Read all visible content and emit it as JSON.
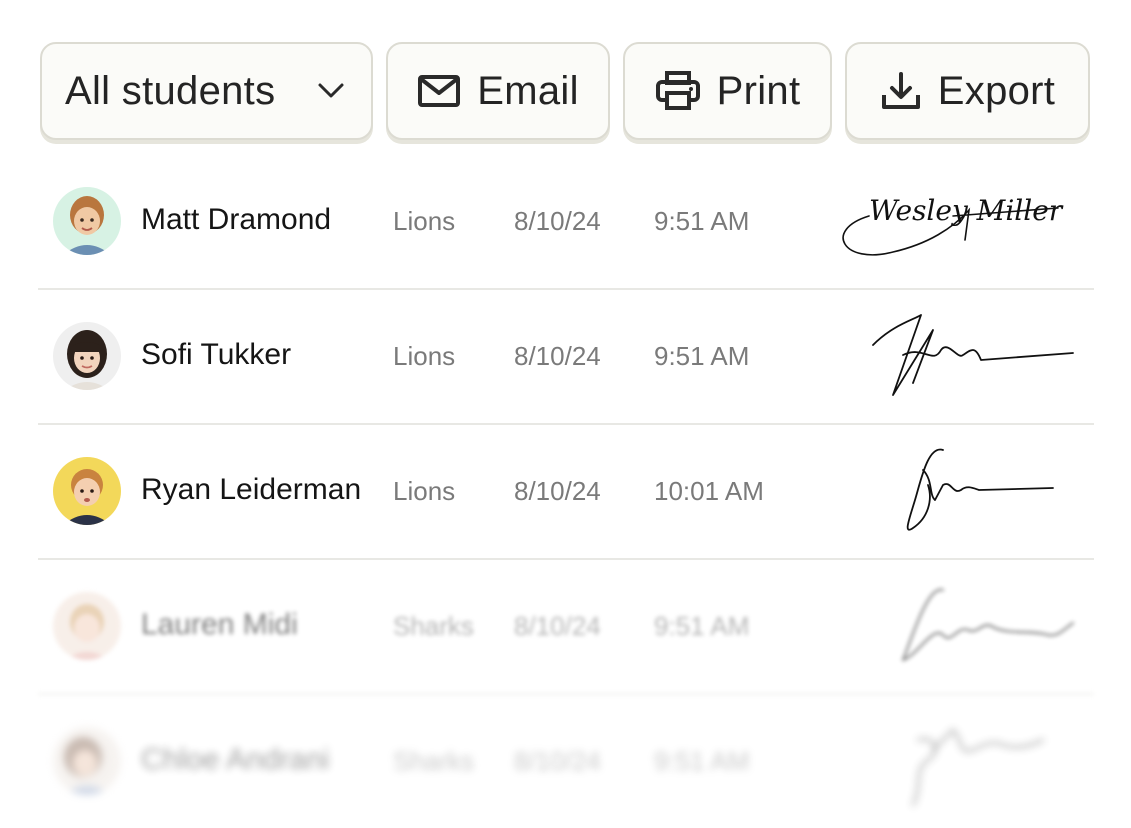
{
  "toolbar": {
    "filter_label": "All students",
    "filter_icon": "chevron-down-icon",
    "email_label": "Email",
    "email_icon": "envelope-icon",
    "print_label": "Print",
    "print_icon": "printer-icon",
    "export_label": "Export",
    "export_icon": "download-icon"
  },
  "students": [
    {
      "name": "Matt Dramond",
      "group": "Lions",
      "date": "8/10/24",
      "time": "9:51 AM",
      "signature_text": "Wesley Miller"
    },
    {
      "name": "Sofi Tukker",
      "group": "Lions",
      "date": "8/10/24",
      "time": "9:51 AM"
    },
    {
      "name": "Ryan Leiderman",
      "group": "Lions",
      "date": "8/10/24",
      "time": "10:01 AM"
    },
    {
      "name": "Lauren Midi",
      "group": "Sharks",
      "date": "8/10/24",
      "time": "9:51 AM"
    },
    {
      "name": "Chloe Andrani",
      "group": "Sharks",
      "date": "8/10/24",
      "time": "9:51 AM"
    }
  ],
  "colors": {
    "button_bg": "#fbfbf8",
    "button_border": "#dcdbd2",
    "divider": "#e8e8e4",
    "muted_text": "#7a7a7a"
  }
}
